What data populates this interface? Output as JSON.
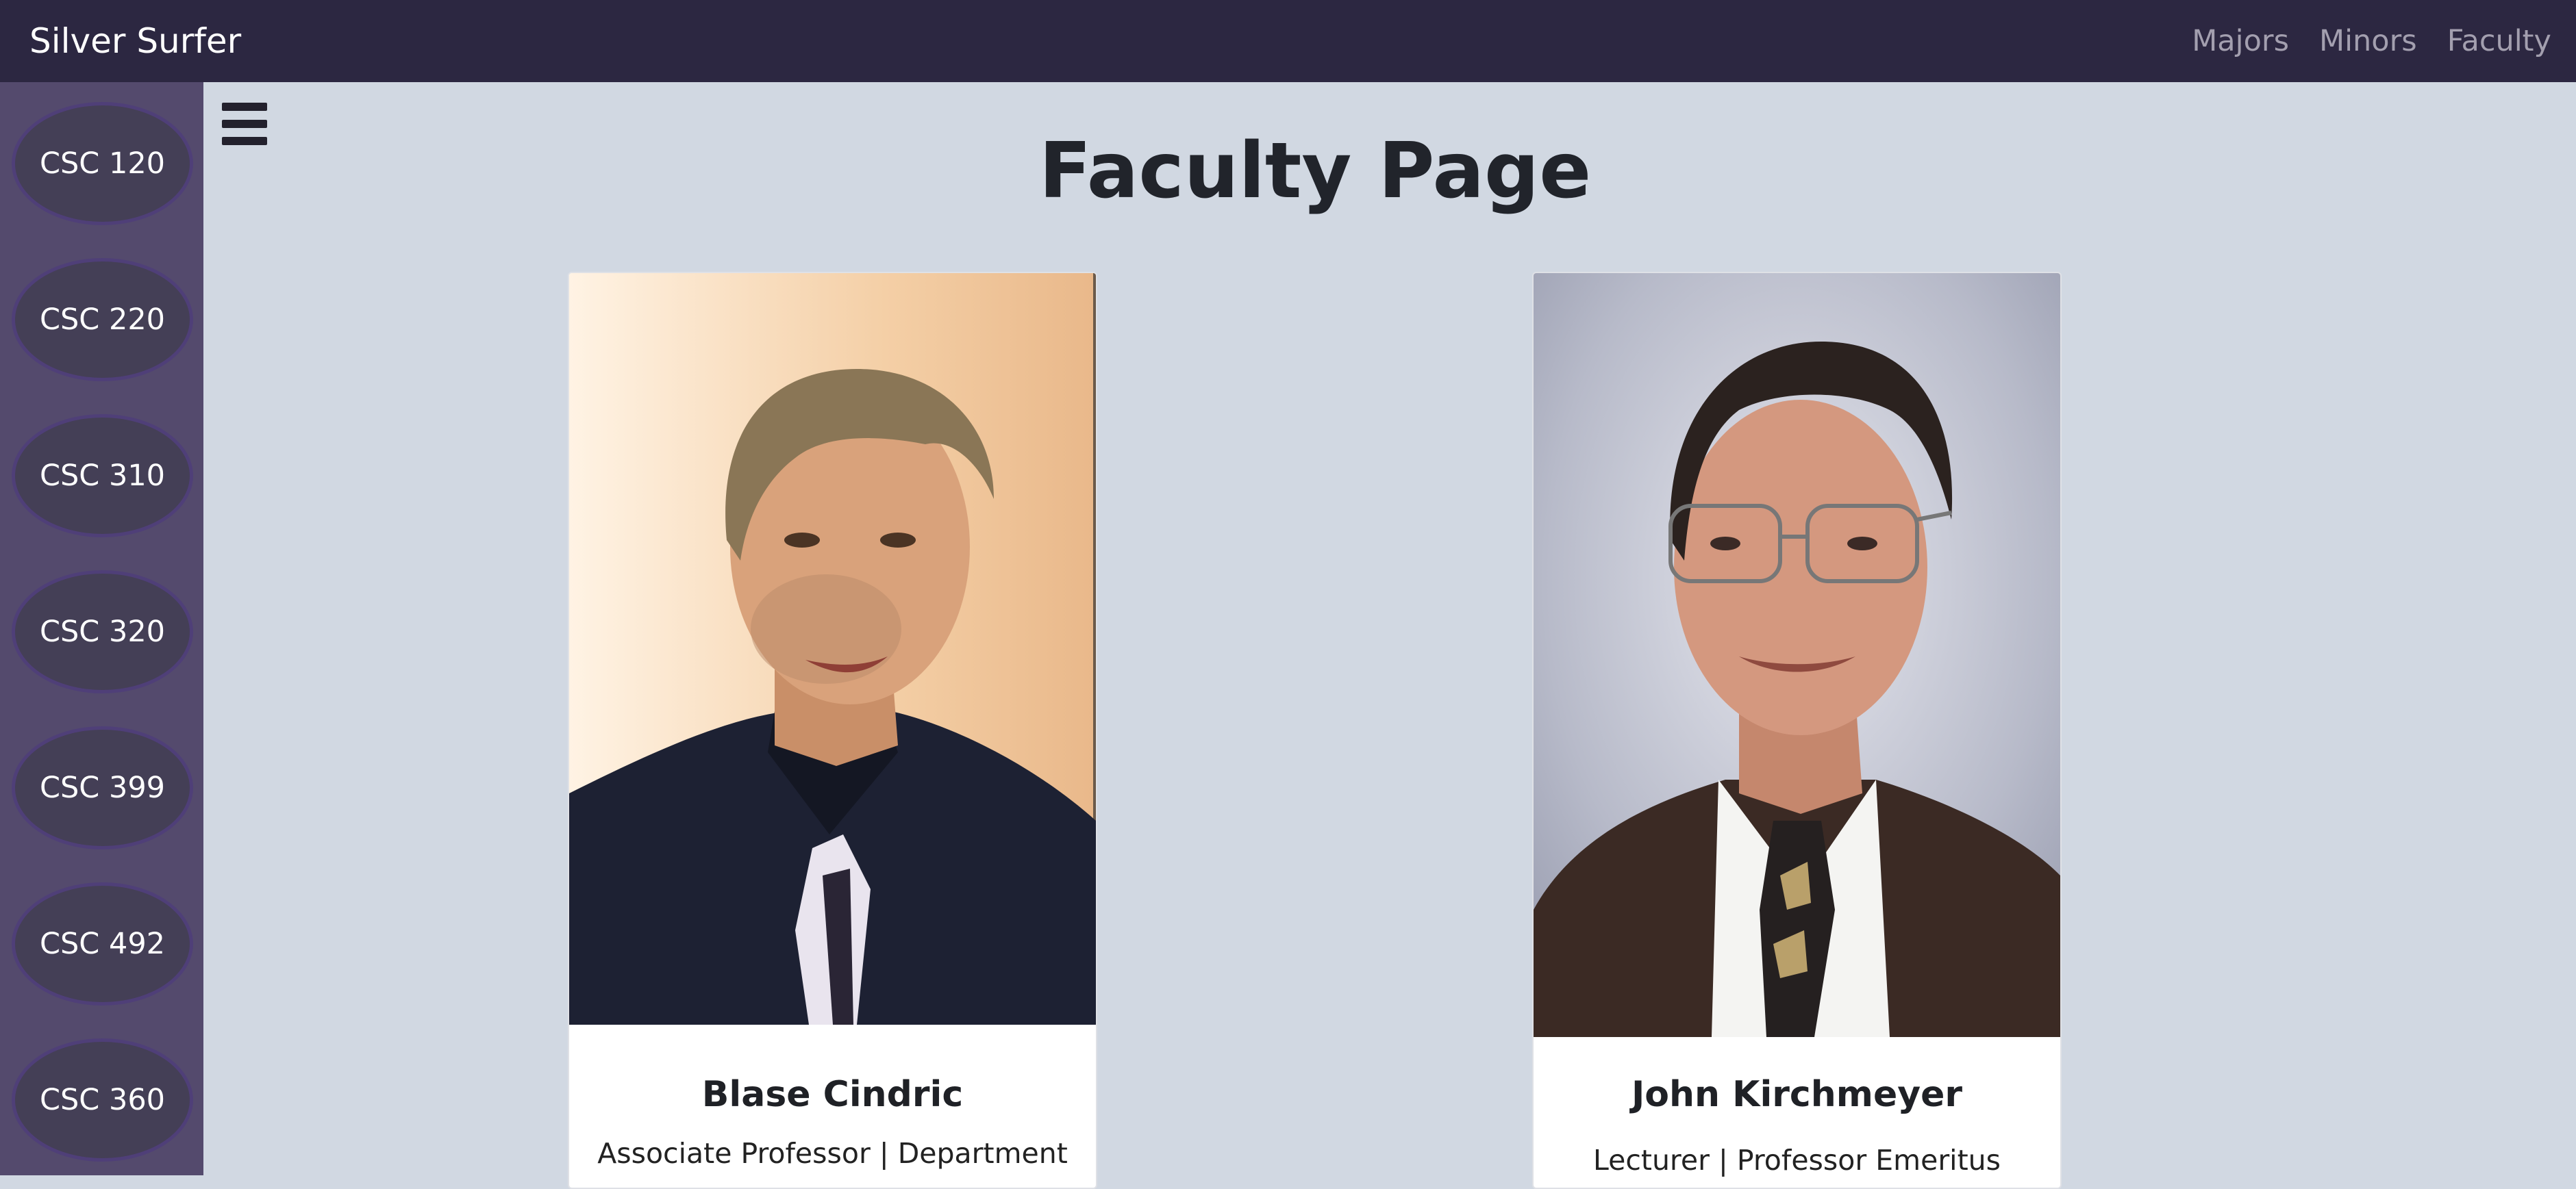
{
  "navbar": {
    "brand": "Silver Surfer",
    "links": [
      "Majors",
      "Minors",
      "Faculty"
    ]
  },
  "sidebar": {
    "courses": [
      "CSC 120",
      "CSC 220",
      "CSC 310",
      "CSC 320",
      "CSC 399",
      "CSC 492",
      "CSC 360"
    ]
  },
  "main": {
    "title": "Faculty Page",
    "faculty": [
      {
        "name": "Blase Cindric",
        "role": "Associate Professor | Department"
      },
      {
        "name": "John Kirchmeyer",
        "role": "Lecturer | Professor Emeritus"
      }
    ]
  },
  "colors": {
    "navbar": "#2c2741",
    "sidebar": "#544a6d",
    "course_bubble": "#443f56",
    "page_background": "#d1d8e2"
  },
  "icons": [
    "hamburger-menu-icon"
  ]
}
